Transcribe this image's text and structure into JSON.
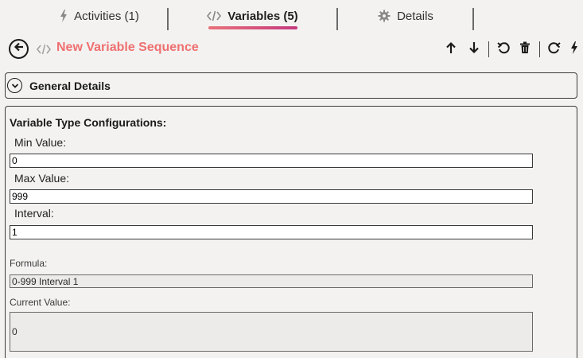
{
  "tabs": [
    {
      "label": "Activities (1)",
      "icon": "lightning-icon"
    },
    {
      "label": "Variables (5)",
      "icon": "code-icon",
      "active": true
    },
    {
      "label": "Details",
      "icon": "gear-icon"
    }
  ],
  "header": {
    "title": "New Variable Sequence",
    "title_color": "#ef7070",
    "toolbar_icons": [
      "arrow-up-icon",
      "arrow-down-icon",
      "undo-icon",
      "trash-icon",
      "refresh-icon",
      "lightning-icon"
    ]
  },
  "general": {
    "label": "General Details"
  },
  "config": {
    "title": "Variable Type Configurations:",
    "min_label": "Min Value:",
    "min_value": "0",
    "max_label": "Max Value:",
    "max_value": "999",
    "interval_label": "Interval:",
    "interval_value": "1",
    "formula_label": "Formula:",
    "formula_value": "0-999 Interval 1",
    "current_label": "Current Value:",
    "current_value": "0"
  },
  "colors": {
    "accent_gradient_start": "#e8737a",
    "accent_gradient_end": "#c43a7e",
    "background": "#f3f2f1"
  }
}
